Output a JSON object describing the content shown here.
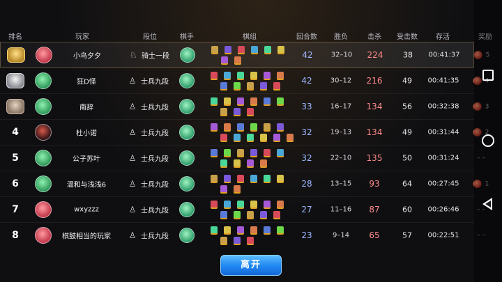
{
  "header": {
    "rank": "排名",
    "player": "玩家",
    "dan": "段位",
    "chessman": "棋手",
    "lineup": "棋组",
    "rounds": "回合数",
    "win_loss": "胜负",
    "kills": "击杀",
    "hits_taken": "受击数",
    "survival": "存活",
    "reward": "奖励"
  },
  "players": [
    {
      "rank": "",
      "medal": "gold",
      "avatar": "red",
      "name": "小鸟夕夕",
      "dan": "骑士一段",
      "dan_icon": "♘",
      "rounds": "42",
      "wl": "32–10",
      "kills": "224",
      "hits": "38",
      "time": "00:41:37",
      "reward": "5",
      "has_reward": true,
      "me": true
    },
    {
      "rank": "",
      "medal": "silver",
      "avatar": "green",
      "name": "狂D怪",
      "dan": "士兵九段",
      "dan_icon": "♙",
      "rounds": "42",
      "wl": "30–12",
      "kills": "216",
      "hits": "49",
      "time": "00:41:35",
      "reward": "4",
      "has_reward": true,
      "me": false
    },
    {
      "rank": "",
      "medal": "bronze",
      "avatar": "green",
      "name": "南辞",
      "dan": "士兵九段",
      "dan_icon": "♙",
      "rounds": "33",
      "wl": "16–17",
      "kills": "134",
      "hits": "56",
      "time": "00:32:38",
      "reward": "3",
      "has_reward": true,
      "me": false
    },
    {
      "rank": "4",
      "medal": "",
      "avatar": "dark",
      "name": "杜小诺",
      "dan": "士兵九段",
      "dan_icon": "♙",
      "rounds": "32",
      "wl": "19–13",
      "kills": "134",
      "hits": "49",
      "time": "00:31:44",
      "reward": "2",
      "has_reward": true,
      "me": false
    },
    {
      "rank": "5",
      "medal": "",
      "avatar": "green",
      "name": "公子苏叶",
      "dan": "士兵九段",
      "dan_icon": "♙",
      "rounds": "32",
      "wl": "22–10",
      "kills": "135",
      "hits": "50",
      "time": "00:31:24",
      "reward": "– –",
      "has_reward": false,
      "me": false
    },
    {
      "rank": "6",
      "medal": "",
      "avatar": "green",
      "name": "温和与浅浅6",
      "dan": "士兵九段",
      "dan_icon": "♙",
      "rounds": "28",
      "wl": "13–15",
      "kills": "93",
      "hits": "64",
      "time": "00:27:45",
      "reward": "1",
      "has_reward": true,
      "me": false
    },
    {
      "rank": "7",
      "medal": "",
      "avatar": "red",
      "name": "wxyzzz",
      "dan": "士兵九段",
      "dan_icon": "♙",
      "rounds": "27",
      "wl": "11–16",
      "kills": "87",
      "hits": "60",
      "time": "00:26:46",
      "reward": "– –",
      "has_reward": false,
      "me": false
    },
    {
      "rank": "8",
      "medal": "",
      "avatar": "red",
      "name": "棋鼓相当的玩家",
      "dan": "士兵九段",
      "dan_icon": "♙",
      "rounds": "23",
      "wl": "9–14",
      "kills": "65",
      "hits": "57",
      "time": "00:22:51",
      "reward": "– –",
      "has_reward": false,
      "me": false
    }
  ],
  "leave_label": "离开",
  "colors": {
    "accent_blue": "#1f86f0",
    "kills_red": "#ff8a8a",
    "rounds_blue": "#9bb7ff",
    "gold": "#f7d27a"
  },
  "icons": {
    "dan_knight": "knight-chess-icon",
    "dan_pawn": "pawn-chess-icon",
    "reward": "reward-ball-icon"
  }
}
